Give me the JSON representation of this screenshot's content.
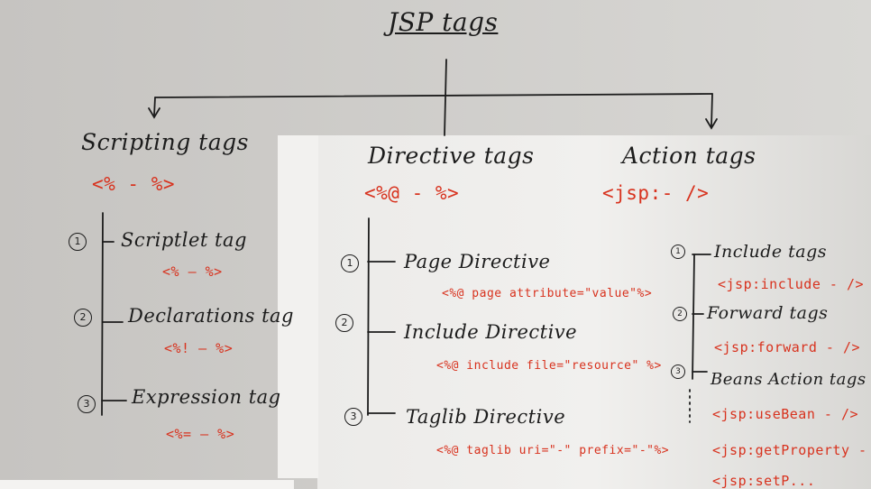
{
  "title": "JSP tags",
  "columns": [
    {
      "heading": "Scripting tags",
      "syntax": "<% - %>",
      "items": [
        {
          "num": "1",
          "label": "Scriptlet tag",
          "code": "<% — %>"
        },
        {
          "num": "2",
          "label": "Declarations tag",
          "code": "<%! — %>"
        },
        {
          "num": "3",
          "label": "Expression tag",
          "code": "<%= — %>"
        }
      ]
    },
    {
      "heading": "Directive tags",
      "syntax": "<%@ - %>",
      "items": [
        {
          "num": "1",
          "label": "Page Directive",
          "code": "<%@ page attribute=\"value\"%>"
        },
        {
          "num": "2",
          "label": "Include Directive",
          "code": "<%@ include file=\"resource\" %>"
        },
        {
          "num": "3",
          "label": "Taglib Directive",
          "code": "<%@ taglib uri=\"-\" prefix=\"-\"%>"
        }
      ]
    },
    {
      "heading": "Action tags",
      "syntax": "<jsp:- />",
      "items": [
        {
          "num": "1",
          "label": "Include tags",
          "code": "<jsp:include - />"
        },
        {
          "num": "2",
          "label": "Forward tags",
          "code": "<jsp:forward - />"
        },
        {
          "num": "3",
          "label": "Beans Action tags",
          "code": "<jsp:useBean - />",
          "code2": "<jsp:getProperty - />",
          "code3": "<jsp:setP..."
        }
      ]
    }
  ]
}
